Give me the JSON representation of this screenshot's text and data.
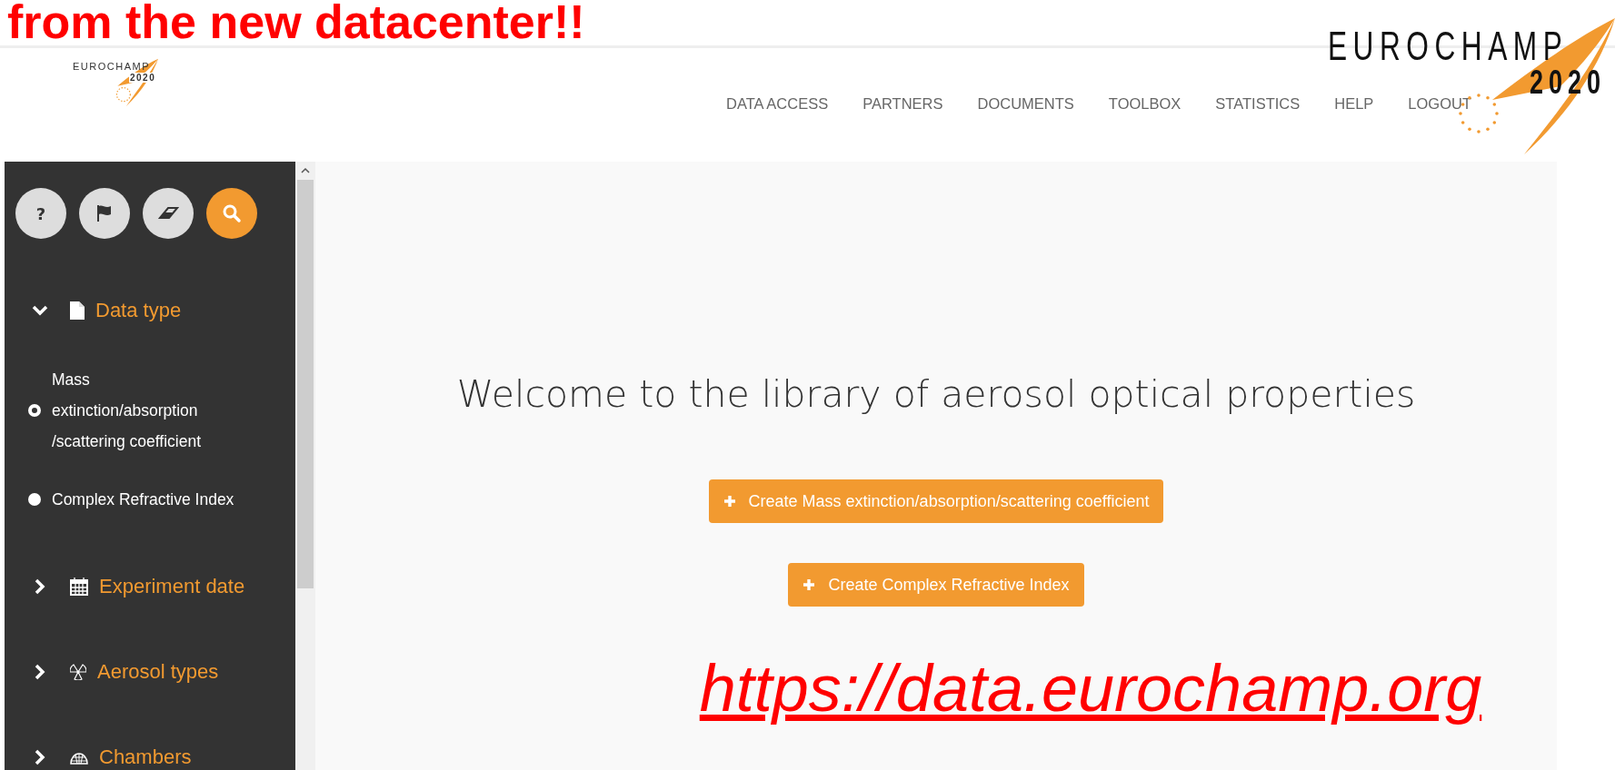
{
  "slide_heading": "from the new datacenter!!",
  "header": {
    "logo": {
      "name": "EUROCHAMP",
      "year": "2020"
    },
    "nav": [
      "DATA ACCESS",
      "PARTNERS",
      "DOCUMENTS",
      "TOOLBOX",
      "STATISTICS",
      "HELP",
      "LOGOUT"
    ]
  },
  "corner_logo": {
    "name": "EUROCHAMP",
    "year": "2020"
  },
  "sidebar": {
    "tool_buttons": [
      {
        "kind": "help",
        "label": "?",
        "selected": false
      },
      {
        "kind": "flag",
        "selected": false
      },
      {
        "kind": "eraser",
        "selected": false
      },
      {
        "kind": "search",
        "selected": true
      }
    ],
    "sections": [
      {
        "label": "Data type",
        "kind": "file",
        "expanded": true,
        "children": [
          {
            "label": "Mass\nextinction/absorption\n/scattering coefficient",
            "selected": true
          },
          {
            "label": "Complex Refractive Index",
            "selected": false
          }
        ]
      },
      {
        "label": "Experiment date",
        "kind": "calendar",
        "expanded": false
      },
      {
        "label": "Aerosol types",
        "kind": "radiation",
        "expanded": false
      },
      {
        "label": "Chambers",
        "kind": "dome",
        "expanded": false
      }
    ]
  },
  "main": {
    "title": "Welcome to the library of aerosol optical properties",
    "buttons": [
      "Create Mass extinction/absorption/scattering coefficient",
      "Create Complex Refractive Index"
    ],
    "link": "https://data.eurochamp.org"
  }
}
